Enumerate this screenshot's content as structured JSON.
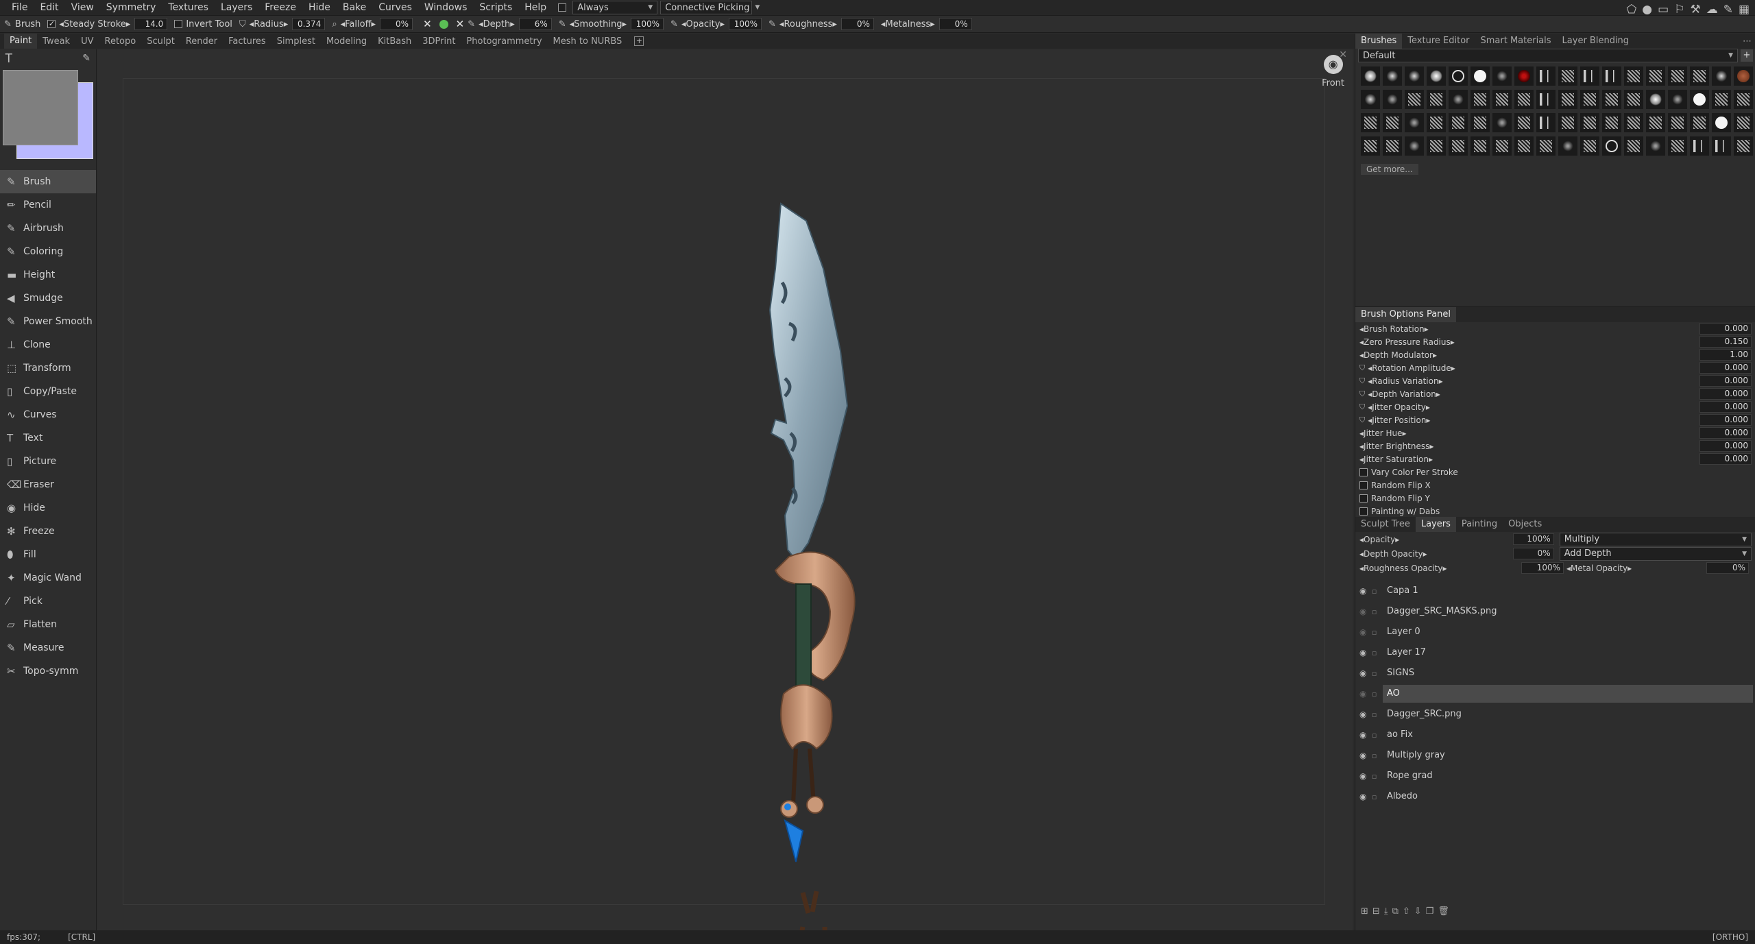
{
  "menu": [
    "File",
    "Edit",
    "View",
    "Symmetry",
    "Textures",
    "Layers",
    "Freeze",
    "Hide",
    "Bake",
    "Curves",
    "Windows",
    "Scripts",
    "Help"
  ],
  "menu_extra": {
    "always_label": "Always",
    "picking_label": "Connective Picking"
  },
  "toolopts": {
    "tool_name": "Brush",
    "steady_label": "Steady Stroke",
    "steady_value": "14.0",
    "invert_label": "Invert Tool",
    "radius_label": "Radius",
    "radius_value": "0.374",
    "falloff_label": "Falloff",
    "falloff_value": "0%",
    "depth_label": "Depth",
    "depth_value": "6%",
    "smoothing_label": "Smoothing",
    "smoothing_value": "100%",
    "opacity_label": "Opacity",
    "opacity_value": "100%",
    "roughness_label": "Roughness",
    "roughness_value": "0%",
    "metalness_label": "Metalness",
    "metalness_value": "0%"
  },
  "rooms": [
    "Paint",
    "Tweak",
    "UV",
    "Retopo",
    "Sculpt",
    "Render",
    "Factures",
    "Simplest",
    "Modeling",
    "KitBash",
    "3DPrint",
    "Photogrammetry",
    "Mesh to NURBS"
  ],
  "active_room": "Paint",
  "colors": {
    "primary": "#7f7f7f",
    "secondary": "#b9b8ff",
    "accent_blue": "#1e7fe0"
  },
  "tools": [
    {
      "label": "Brush",
      "icon": "brush-icon"
    },
    {
      "label": "Pencil",
      "icon": "pencil-icon"
    },
    {
      "label": "Airbrush",
      "icon": "airbrush-icon"
    },
    {
      "label": "Coloring",
      "icon": "coloring-icon"
    },
    {
      "label": "Height",
      "icon": "height-icon"
    },
    {
      "label": "Smudge",
      "icon": "smudge-icon"
    },
    {
      "label": "Power Smooth",
      "icon": "power-smooth-icon"
    },
    {
      "label": "Clone",
      "icon": "clone-icon"
    },
    {
      "label": "Transform",
      "icon": "transform-icon"
    },
    {
      "label": "Copy/Paste",
      "icon": "copy-paste-icon"
    },
    {
      "label": "Curves",
      "icon": "curves-icon"
    },
    {
      "label": "Text",
      "icon": "text-icon"
    },
    {
      "label": "Picture",
      "icon": "picture-icon"
    },
    {
      "label": "Eraser",
      "icon": "eraser-icon"
    },
    {
      "label": "Hide",
      "icon": "eye-icon"
    },
    {
      "label": "Freeze",
      "icon": "snowflake-icon"
    },
    {
      "label": "Fill",
      "icon": "bucket-icon"
    },
    {
      "label": "Magic Wand",
      "icon": "magic-wand-icon"
    },
    {
      "label": "Pick",
      "icon": "pick-icon"
    },
    {
      "label": "Flatten",
      "icon": "flatten-icon"
    },
    {
      "label": "Measure",
      "icon": "measure-icon"
    },
    {
      "label": "Topo-symm",
      "icon": "topo-symm-icon"
    }
  ],
  "viewport": {
    "camera_label": "Front"
  },
  "right_tabs": [
    "Brushes",
    "Texture Editor",
    "Smart Materials",
    "Layer Blending"
  ],
  "brush_set": "Default",
  "get_more": "Get more...",
  "brush_options": {
    "title": "Brush Options Panel",
    "params": [
      {
        "label": "Brush Rotation",
        "value": "0.000",
        "linked": false
      },
      {
        "label": "Zero Pressure Radius",
        "value": "0.150",
        "linked": false
      },
      {
        "label": "Depth Modulator",
        "value": "1.00",
        "linked": false
      },
      {
        "label": "Rotation Amplitude",
        "value": "0.000",
        "linked": true
      },
      {
        "label": "Radius Variation",
        "value": "0.000",
        "linked": true
      },
      {
        "label": "Depth Variation",
        "value": "0.000",
        "linked": true
      },
      {
        "label": "Jitter Opacity",
        "value": "0.000",
        "linked": true
      },
      {
        "label": "Jitter Position",
        "value": "0.000",
        "linked": true
      },
      {
        "label": "Jitter Hue",
        "value": "0.000",
        "linked": false
      },
      {
        "label": "Jitter Brightness",
        "value": "0.000",
        "linked": false
      },
      {
        "label": "Jitter Saturation",
        "value": "0.000",
        "linked": false
      }
    ],
    "checks": [
      "Vary Color Per Stroke",
      "Random Flip X",
      "Random Flip Y",
      "Painting w/ Dabs"
    ]
  },
  "layer_tabs": [
    "Sculpt Tree",
    "Layers",
    "Painting",
    "Objects"
  ],
  "active_layer_tab": "Layers",
  "layer_props": {
    "opacity_label": "Opacity",
    "opacity_value": "100%",
    "blend_mode": "Multiply",
    "depth_opacity_label": "Depth Opacity",
    "depth_opacity_value": "0%",
    "depth_mode": "Add Depth",
    "roughness_opacity_label": "Roughness Opacity",
    "roughness_opacity_value": "100%",
    "metal_opacity_label": "Metal Opacity",
    "metal_opacity_value": "0%"
  },
  "layers": [
    {
      "name": "Capa 1",
      "visible": true
    },
    {
      "name": "Dagger_SRC_MASKS.png",
      "visible": false
    },
    {
      "name": "Layer 0",
      "visible": false
    },
    {
      "name": "Layer 17",
      "visible": true
    },
    {
      "name": "SIGNS",
      "visible": true
    },
    {
      "name": "AO",
      "visible": false,
      "active": true
    },
    {
      "name": "Dagger_SRC.png",
      "visible": true
    },
    {
      "name": "ao Fix",
      "visible": true
    },
    {
      "name": "Multiply gray",
      "visible": true
    },
    {
      "name": "Rope grad",
      "visible": true
    },
    {
      "name": "Albedo",
      "visible": true
    }
  ],
  "status": {
    "fps": "fps:307;",
    "mod": "[CTRL]",
    "projection": "[ORTHO]"
  }
}
